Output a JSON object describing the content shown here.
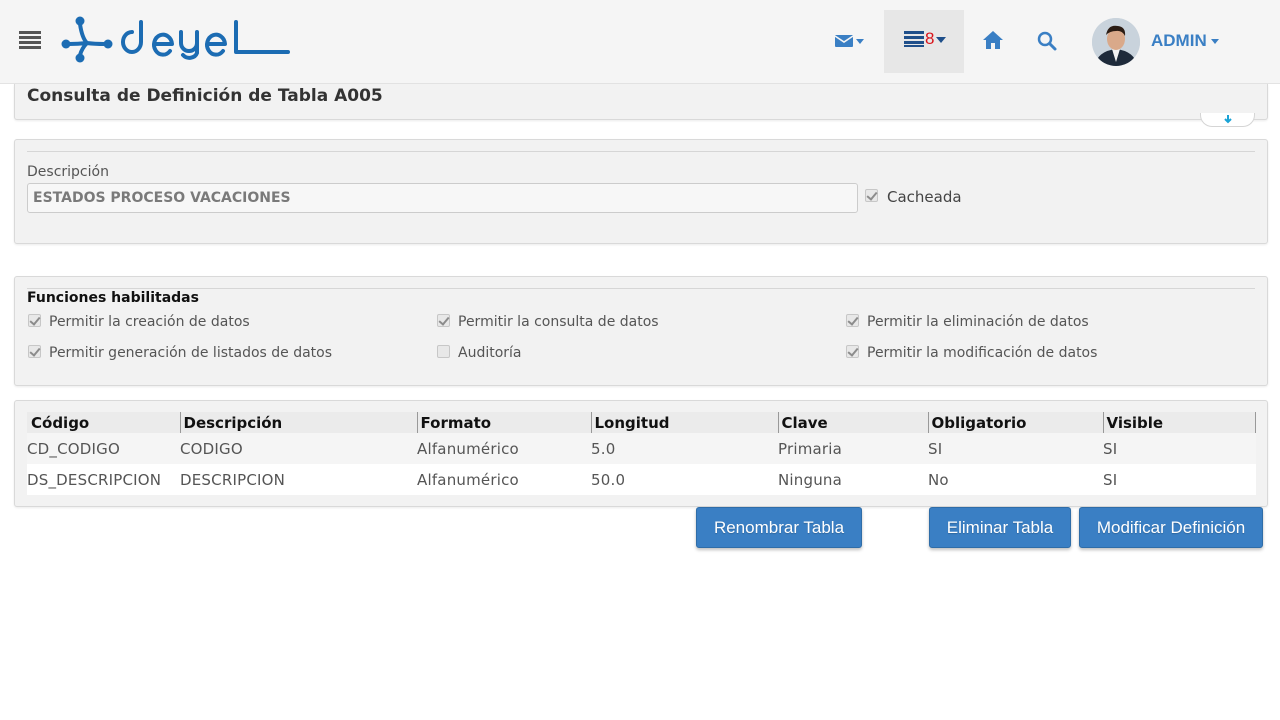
{
  "colors": {
    "brand": "#3a7fc4",
    "badge": "#d9141b",
    "logo": "#1c6cb3"
  },
  "header": {
    "menu_icon": "hamburger-icon",
    "logo_alt": "deyel",
    "mail_icon": "envelope-icon",
    "tasks_icon": "tasks-list-icon",
    "tasks_count": "8",
    "home_icon": "home-icon",
    "search_icon": "search-icon",
    "user_name": "ADMIN"
  },
  "page": {
    "title": "Consulta de Definición de Tabla A005"
  },
  "description_section": {
    "label": "Descripción",
    "value": "ESTADOS PROCESO VACACIONES",
    "cached_label": "Cacheada",
    "cached_checked": true
  },
  "functions": {
    "title": "Funciones habilitadas",
    "items": [
      {
        "label": "Permitir la creación de datos",
        "checked": true
      },
      {
        "label": "Permitir la consulta de datos",
        "checked": true
      },
      {
        "label": "Permitir la eliminación de datos",
        "checked": true
      },
      {
        "label": "Permitir generación de listados de datos",
        "checked": true
      },
      {
        "label": "Auditoría",
        "checked": false
      },
      {
        "label": "Permitir la modificación de datos",
        "checked": true
      }
    ]
  },
  "fields_table": {
    "headers": [
      "Código",
      "Descripción",
      "Formato",
      "Longitud",
      "Clave",
      "Obligatorio",
      "Visible"
    ],
    "rows": [
      [
        "CD_CODIGO",
        "CODIGO",
        "Alfanumérico",
        "5.0",
        "Primaria",
        "SI",
        "SI"
      ],
      [
        "DS_DESCRIPCION",
        "DESCRIPCION",
        "Alfanumérico",
        "50.0",
        "Ninguna",
        "No",
        "SI"
      ]
    ]
  },
  "actions": {
    "rename": "Renombrar Tabla",
    "delete": "Eliminar Tabla",
    "modify": "Modificar Definición"
  }
}
